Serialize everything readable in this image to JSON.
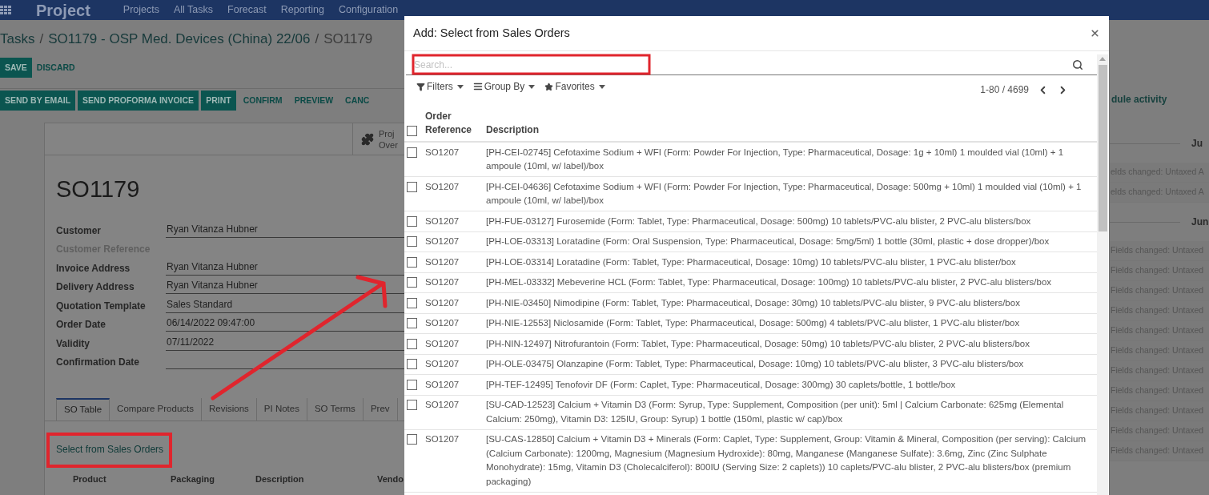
{
  "navbar": {
    "app_title": "Project",
    "menu": [
      "Projects",
      "All Tasks",
      "Forecast",
      "Reporting",
      "Configuration"
    ]
  },
  "breadcrumb": {
    "separator": "/",
    "items": [
      {
        "label": "Tasks",
        "current": false
      },
      {
        "label": "SO1179 - OSP Med. Devices (China) 22/06",
        "current": false
      },
      {
        "label": "SO1179",
        "current": true
      }
    ]
  },
  "form_buttons": [
    {
      "label": "SAVE",
      "kind": "primary"
    },
    {
      "label": "DISCARD",
      "kind": "link"
    }
  ],
  "action_buttons": [
    {
      "label": "SEND BY EMAIL",
      "kind": "primary"
    },
    {
      "label": "SEND PROFORMA INVOICE",
      "kind": "primary"
    },
    {
      "label": "PRINT",
      "kind": "primary"
    },
    {
      "label": "CONFIRM",
      "kind": "link"
    },
    {
      "label": "PREVIEW",
      "kind": "link"
    },
    {
      "label": "CANC",
      "kind": "link"
    }
  ],
  "smart_button": {
    "line_1": "Proj",
    "line_2": "Over"
  },
  "record": {
    "title": "SO1179",
    "fields": [
      {
        "label": "Customer",
        "value": "Ryan Vitanza Hubner",
        "muted": false
      },
      {
        "label": "Customer Reference",
        "muted": true
      },
      {
        "label": "Invoice Address",
        "value": "Ryan Vitanza Hubner",
        "muted": false
      },
      {
        "label": "Delivery Address",
        "value": "Ryan Vitanza Hubner",
        "muted": false
      },
      {
        "label": "Quotation Template",
        "value": "Sales Standard",
        "muted": false
      },
      {
        "label": "Order Date",
        "value": "06/14/2022 09:47:00",
        "muted": false
      },
      {
        "label": "Validity",
        "value": "07/11/2022",
        "muted": false
      },
      {
        "label": "Confirmation Date",
        "muted": false
      }
    ]
  },
  "tabs": [
    {
      "label": "SO Table",
      "selected": true
    },
    {
      "label": "Compare Products",
      "selected": false
    },
    {
      "label": "Revisions",
      "selected": false
    },
    {
      "label": "PI Notes",
      "selected": false
    },
    {
      "label": "SO Terms",
      "selected": false
    },
    {
      "label": "Prev",
      "selected": false
    }
  ],
  "select_link": "Select from Sales Orders",
  "lines_columns": [
    "Product",
    "Packaging",
    "Description",
    "Vendo"
  ],
  "chatter": {
    "activity_link": "dule activity",
    "items": [
      {
        "kind": "date",
        "text": "Ju"
      },
      {
        "kind": "message",
        "text": "elds changed: Untaxed A"
      },
      {
        "kind": "message",
        "text": "elds changed: Untaxed A"
      },
      {
        "kind": "date",
        "text": "Jun"
      },
      {
        "kind": "message",
        "text": "Fields changed: Untaxed"
      },
      {
        "kind": "message",
        "text": "Fields changed: Untaxed"
      },
      {
        "kind": "message",
        "text": "Fields changed: Untaxed"
      },
      {
        "kind": "message",
        "text": "Fields changed: Untaxed"
      },
      {
        "kind": "message",
        "text": "Fields changed: Untaxed"
      },
      {
        "kind": "message",
        "text": "Fields changed: Untaxed"
      },
      {
        "kind": "message",
        "text": "Fields changed: Untaxed"
      },
      {
        "kind": "message",
        "text": "Fields changed: Untaxed"
      },
      {
        "kind": "message",
        "text": "Fields changed: Untaxed"
      },
      {
        "kind": "message",
        "text": "Fields changed: Untaxed"
      },
      {
        "kind": "message",
        "text": "Fields changed: Untaxed"
      }
    ]
  },
  "dialog": {
    "title": "Add: Select from Sales Orders",
    "search": {
      "placeholder": "Search..."
    },
    "filters": [
      "Filters",
      "Group By",
      "Favorites"
    ],
    "pager": "1-80 / 4699",
    "columns": [
      "Order Reference",
      "Description"
    ],
    "select_all": {
      "checked": false
    },
    "rows": [
      {
        "order": "SO1207",
        "description": "[PH-CEI-02745] Cefotaxime Sodium + WFI (Form: Powder For Injection, Type: Pharmaceutical, Dosage: 1g + 10ml) 1 moulded vial (10ml) + 1 ampoule (10ml, w/ label)/box",
        "checked": false
      },
      {
        "order": "SO1207",
        "description": "[PH-CEI-04636] Cefotaxime Sodium + WFI (Form: Powder For Injection, Type: Pharmaceutical, Dosage: 500mg + 10ml) 1 moulded vial (10ml) + 1 ampoule (10ml, w/ label)/box",
        "checked": false
      },
      {
        "order": "SO1207",
        "description": "[PH-FUE-03127] Furosemide (Form: Tablet, Type: Pharmaceutical, Dosage: 500mg) 10 tablets/PVC-alu blister, 2 PVC-alu blisters/box",
        "checked": false
      },
      {
        "order": "SO1207",
        "description": "[PH-LOE-03313] Loratadine (Form: Oral Suspension, Type: Pharmaceutical, Dosage: 5mg/5ml) 1 bottle (30ml, plastic + dose dropper)/box",
        "checked": false
      },
      {
        "order": "SO1207",
        "description": "[PH-LOE-03314] Loratadine (Form: Tablet, Type: Pharmaceutical, Dosage: 10mg) 10 tablets/PVC-alu blister, 1 PVC-alu blister/box",
        "checked": false
      },
      {
        "order": "SO1207",
        "description": "[PH-MEL-03332] Mebeverine HCL (Form: Tablet, Type: Pharmaceutical, Dosage: 100mg) 10 tablets/PVC-alu blister, 2 PVC-alu blisters/box",
        "checked": false
      },
      {
        "order": "SO1207",
        "description": "[PH-NIE-03450] Nimodipine (Form: Tablet, Type: Pharmaceutical, Dosage: 30mg) 10 tablets/PVC-alu blister, 9 PVC-alu blisters/box",
        "checked": false
      },
      {
        "order": "SO1207",
        "description": "[PH-NIE-12553] Niclosamide (Form: Tablet, Type: Pharmaceutical, Dosage: 500mg) 4 tablets/PVC-alu blister, 1 PVC-alu blister/box",
        "checked": false
      },
      {
        "order": "SO1207",
        "description": "[PH-NIN-12497] Nitrofurantoin (Form: Tablet, Type: Pharmaceutical, Dosage: 50mg) 10 tablets/PVC-alu blister, 2 PVC-alu blisters/box",
        "checked": false
      },
      {
        "order": "SO1207",
        "description": "[PH-OLE-03475] Olanzapine (Form: Tablet, Type: Pharmaceutical, Dosage: 10mg) 10 tablets/PVC-alu blister, 3 PVC-alu blisters/box",
        "checked": false
      },
      {
        "order": "SO1207",
        "description": "[PH-TEF-12495] Tenofovir DF (Form: Caplet, Type: Pharmaceutical, Dosage: 300mg) 30 caplets/bottle, 1 bottle/box",
        "checked": false
      },
      {
        "order": "SO1207",
        "description": "[SU-CAD-12523] Calcium + Vitamin D3 (Form: Syrup, Type: Supplement, Composition (per unit): 5ml | Calcium Carbonate: 625mg (Elemental Calcium: 250mg), Vitamin D3: 125IU, Group: Syrup) 1 bottle (150ml, plastic w/ cap)/box",
        "checked": false
      },
      {
        "order": "SO1207",
        "description": "[SU-CAS-12850] Calcium + Vitamin D3 + Minerals (Form: Caplet, Type: Supplement, Group: Vitamin & Mineral, Composition (per serving): Calcium (Calcium Carbonate): 1200mg, Magnesium (Magnesium Hydroxide): 80mg, Manganese (Manganese Sulfate): 3.6mg, Zinc (Zinc Sulphate Monohydrate): 15mg, Vitamin D3 (Cholecalciferol): 800IU (Serving Size: 2 caplets)) 10 caplets/PVC-alu blister, 2 PVC-alu blisters/box (premium packaging)",
        "checked": false
      }
    ]
  }
}
